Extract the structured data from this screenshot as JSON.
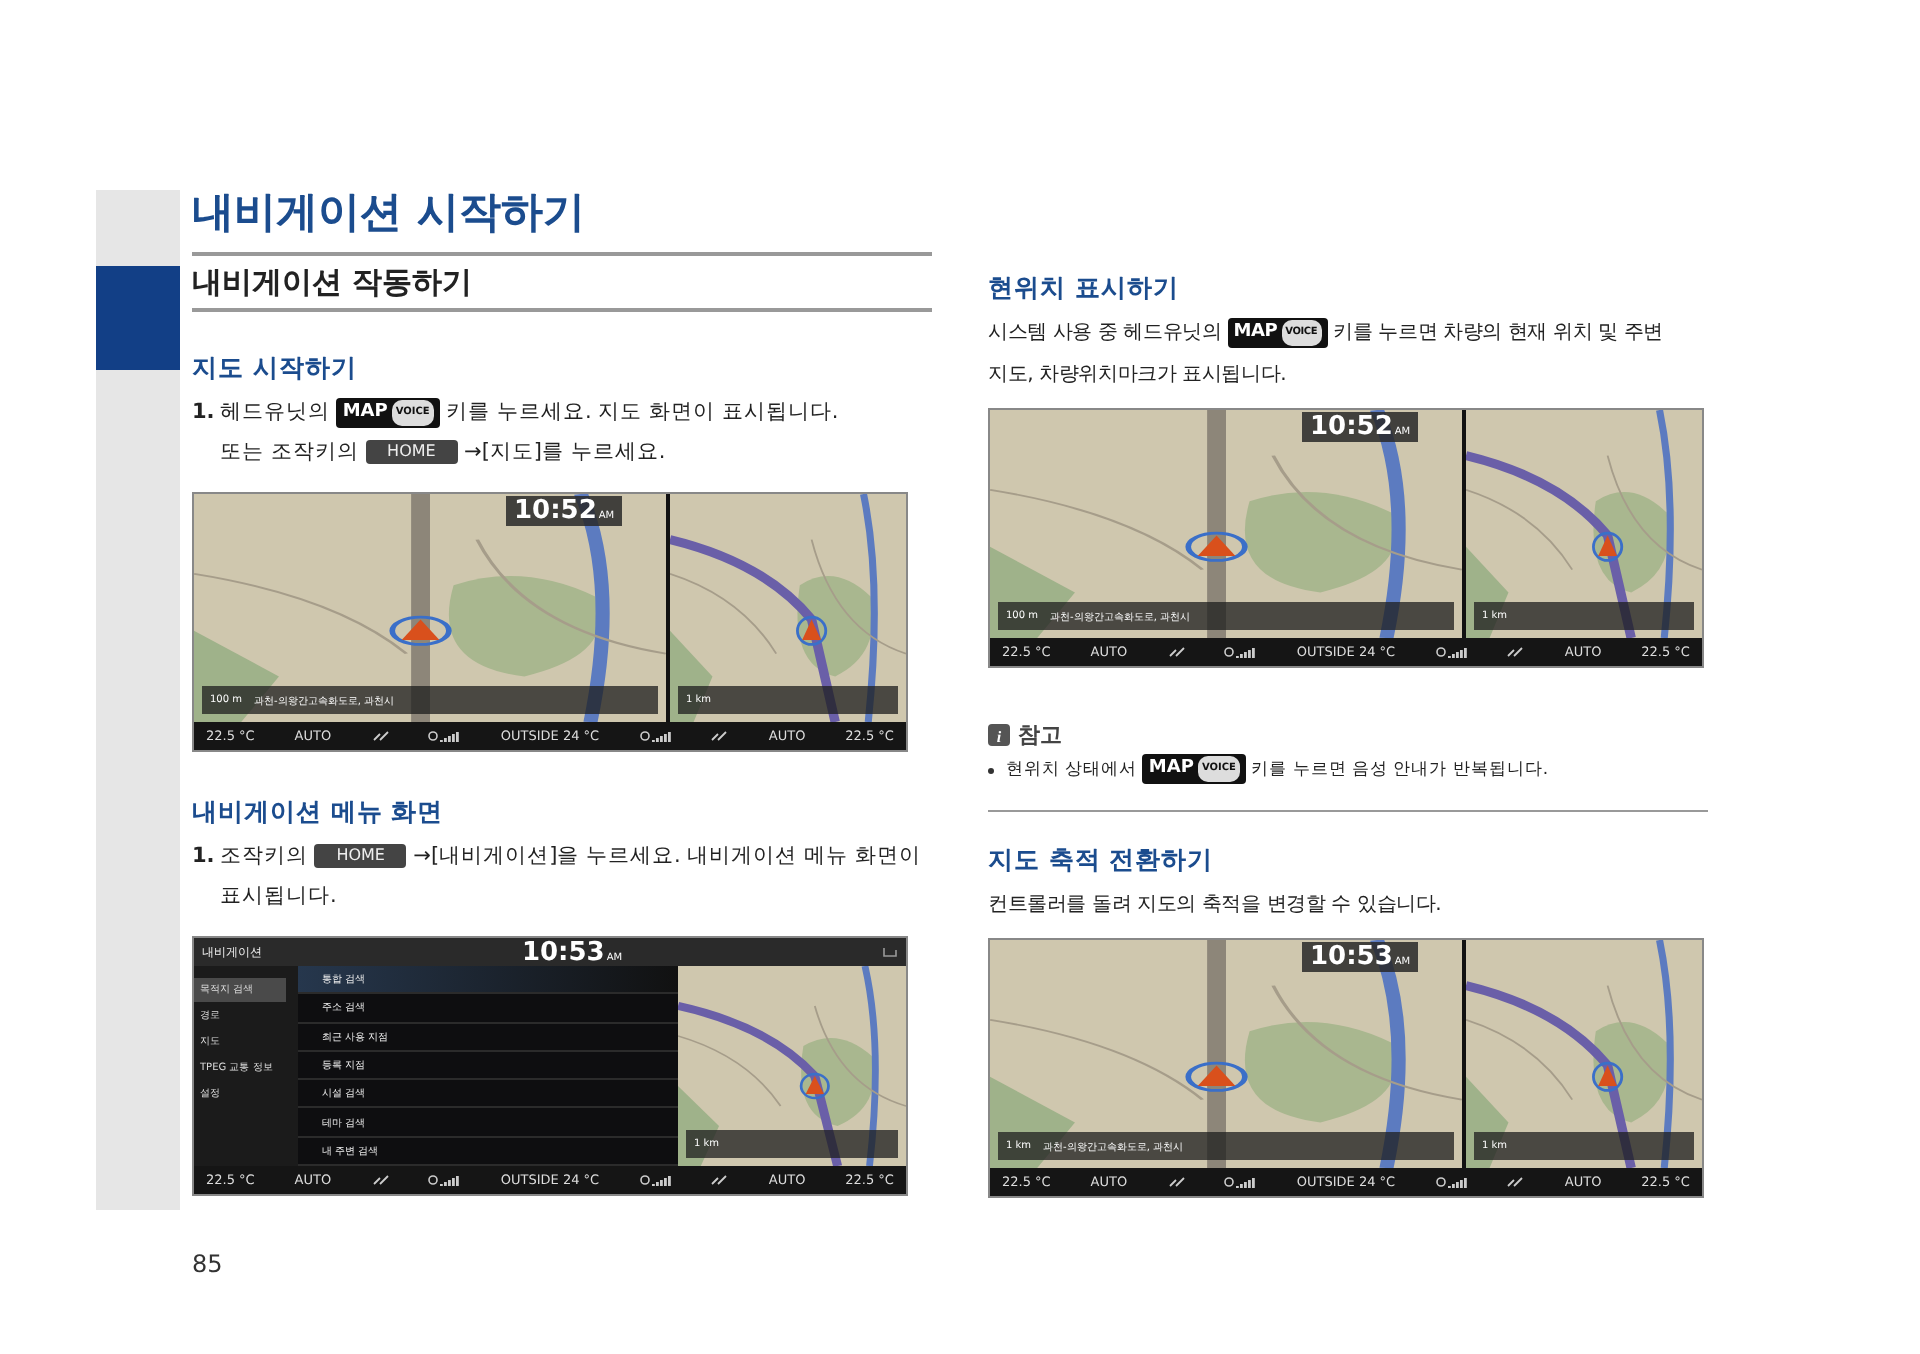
{
  "page_title": "내비게이션 시작하기",
  "page_number": "85",
  "left_column": [
    {
      "kind": "heading",
      "text": "내비게이션 작동하기"
    },
    {
      "kind": "title",
      "text": "지도 시작하기"
    },
    {
      "kind": "step",
      "number": "1.",
      "lines": [
        [
          {
            "kind": "text",
            "text": "헤드유닛의 "
          },
          {
            "kind": "map_key",
            "label": "MAP",
            "sub": "VOICE"
          },
          {
            "kind": "text",
            "text": " 키를 누르세요. 지도 화면이 표시됩니다."
          }
        ],
        [
          {
            "kind": "text",
            "text": "또는 조작키의 "
          },
          {
            "kind": "key",
            "label": "HOME"
          },
          {
            "kind": "text",
            "text": " →[지도]를 누르세요."
          }
        ]
      ]
    },
    {
      "kind": "screen",
      "screen": {
        "kind": "map",
        "time": "10:52",
        "meridiem": "AM",
        "panes": [
          {
            "scale": "100 m",
            "route": "과천-의왕간고속화도로, 과천시"
          },
          {
            "scale": "1 km"
          }
        ],
        "status": [
          "22.5 °C",
          "AUTO",
          "OUTSIDE 24 °C",
          "AUTO",
          "22.5 °C"
        ]
      }
    },
    {
      "kind": "title",
      "text": "내비게이션 메뉴 화면"
    },
    {
      "kind": "step",
      "number": "1.",
      "lines": [
        [
          {
            "kind": "text",
            "text": "조작키의 "
          },
          {
            "kind": "key",
            "label": "HOME"
          },
          {
            "kind": "text",
            "text": " →[내비게이션]을 누르세요. 내비게이션 메뉴 화면이 표시됩니다."
          }
        ]
      ]
    },
    {
      "kind": "screen",
      "screen": {
        "kind": "menu",
        "header": "내비게이션",
        "time": "10:53",
        "meridiem": "AM",
        "categories": [
          {
            "label": "목적지 검색",
            "selected": true
          },
          {
            "label": "경로",
            "selected": false
          },
          {
            "label": "지도",
            "selected": false
          },
          {
            "label": "TPEG 교통 정보",
            "selected": false
          },
          {
            "label": "설정",
            "selected": false
          }
        ],
        "items": [
          {
            "label": "통합 검색",
            "selected": true
          },
          {
            "label": "주소 검색",
            "selected": false
          },
          {
            "label": "최근 사용 지점",
            "selected": false
          },
          {
            "label": "등록 지점",
            "selected": false
          },
          {
            "label": "시설 검색",
            "selected": false
          },
          {
            "label": "테마 검색",
            "selected": false
          },
          {
            "label": "내 주변 검색",
            "selected": false
          }
        ],
        "panes": [
          {
            "scale": "1 km"
          }
        ],
        "status": [
          "22.5 °C",
          "AUTO",
          "OUTSIDE 24 °C",
          "AUTO",
          "22.5 °C"
        ]
      }
    }
  ],
  "right_column": [
    {
      "kind": "title",
      "text": "현위치 표시하기"
    },
    {
      "kind": "paragraph",
      "lines": [
        [
          {
            "kind": "text",
            "text": "시스템 사용 중 헤드유닛의 "
          },
          {
            "kind": "map_key",
            "label": "MAP",
            "sub": "VOICE"
          },
          {
            "kind": "text",
            "text": " 키를 누르면 차량의 현재 위치 및 주변"
          }
        ],
        [
          {
            "kind": "text",
            "text": "지도, 차량위치마크가 표시됩니다."
          }
        ]
      ]
    },
    {
      "kind": "screen",
      "screen": {
        "kind": "map",
        "time": "10:52",
        "meridiem": "AM",
        "panes": [
          {
            "scale": "100 m",
            "route": "과천-의왕간고속화도로, 과천시"
          },
          {
            "scale": "1 km"
          }
        ],
        "status": [
          "22.5 °C",
          "AUTO",
          "OUTSIDE 24 °C",
          "AUTO",
          "22.5 °C"
        ]
      }
    },
    {
      "kind": "note",
      "icon_text": "i",
      "label": "참고",
      "bullets": [
        [
          {
            "kind": "text",
            "text": "현위치 상태에서 "
          },
          {
            "kind": "map_key",
            "label": "MAP",
            "sub": "VOICE"
          },
          {
            "kind": "text",
            "text": " 키를 누르면 음성 안내가 반복됩니다."
          }
        ]
      ]
    },
    {
      "kind": "title",
      "text": "지도 축적 전환하기"
    },
    {
      "kind": "paragraph",
      "lines": [
        [
          {
            "kind": "text",
            "text": "컨트롤러를 돌려 지도의 축적을 변경할 수 있습니다."
          }
        ]
      ]
    },
    {
      "kind": "screen",
      "screen": {
        "kind": "map",
        "time": "10:53",
        "meridiem": "AM",
        "panes": [
          {
            "scale": "1 km",
            "route": "과천-의왕간고속화도로, 과천시"
          },
          {
            "scale": "1 km"
          }
        ],
        "status": [
          "22.5 °C",
          "AUTO",
          "OUTSIDE 24 °C",
          "AUTO",
          "22.5 °C"
        ]
      }
    }
  ]
}
